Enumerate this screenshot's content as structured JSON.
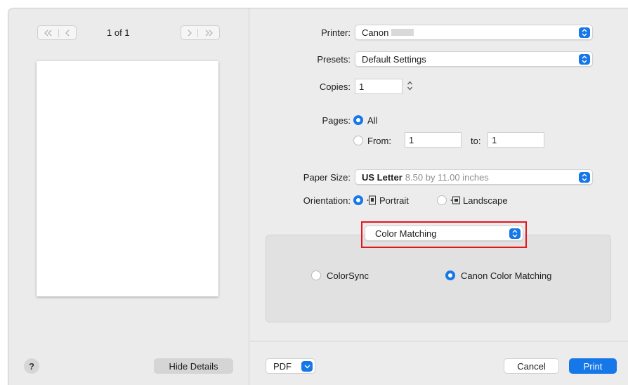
{
  "preview": {
    "page_counter": "1 of 1",
    "help_label": "?",
    "hide_details_label": "Hide Details"
  },
  "printer": {
    "label": "Printer:",
    "value": "Canon"
  },
  "presets": {
    "label": "Presets:",
    "value": "Default Settings"
  },
  "copies": {
    "label": "Copies:",
    "value": "1"
  },
  "pages": {
    "label": "Pages:",
    "all_label": "All",
    "from_label": "From:",
    "from_value": "1",
    "to_label": "to:",
    "to_value": "1",
    "selected": "All"
  },
  "paper_size": {
    "label": "Paper Size:",
    "value": "US Letter",
    "detail": "8.50 by 11.00 inches"
  },
  "orientation": {
    "label": "Orientation:",
    "portrait_label": "Portrait",
    "landscape_label": "Landscape",
    "selected": "Portrait"
  },
  "section_menu": {
    "value": "Color Matching"
  },
  "color_matching": {
    "colorsync_label": "ColorSync",
    "canon_label": "Canon Color Matching",
    "selected": "Canon Color Matching"
  },
  "footer": {
    "pdf_label": "PDF",
    "cancel_label": "Cancel",
    "print_label": "Print"
  },
  "colors": {
    "accent": "#1677e8",
    "highlight": "#e4161c",
    "panel": "#ececec"
  },
  "icons": [
    "first-page-icon",
    "previous-page-icon",
    "next-page-icon",
    "last-page-icon",
    "popup-chevron-icon",
    "stepper-icon",
    "portrait-orientation-icon",
    "landscape-orientation-icon",
    "dropdown-chevron-icon"
  ]
}
